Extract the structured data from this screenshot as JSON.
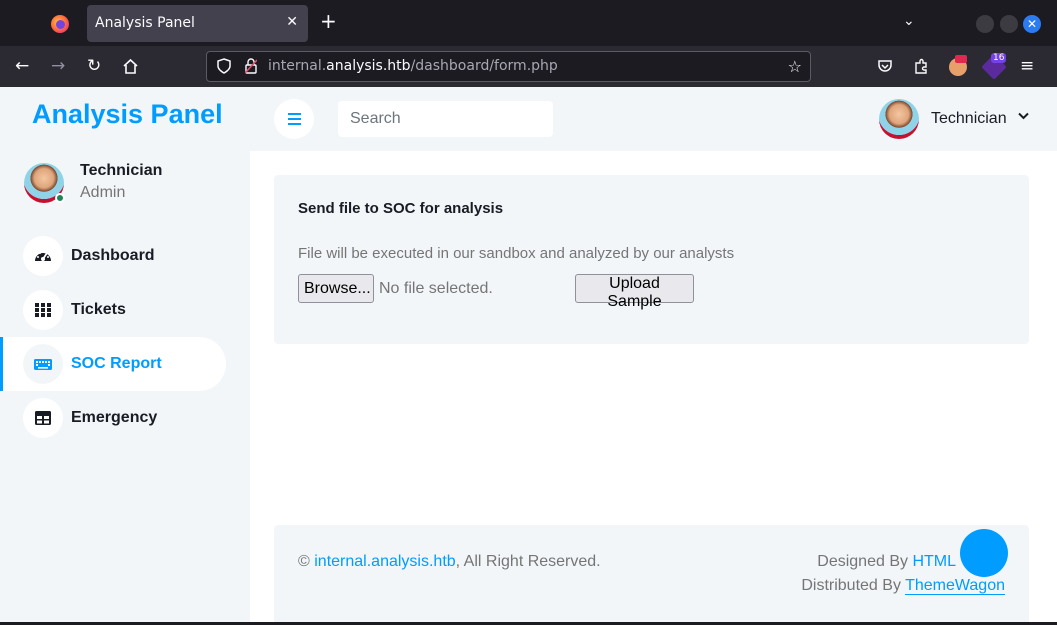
{
  "browser": {
    "tab_title": "Analysis Panel",
    "tab_close": "✕",
    "new_tab": "+",
    "tab_list": "⌄",
    "window_close": "✕",
    "url_prefix": "internal.",
    "url_host": "analysis.htb",
    "url_path": "/dashboard/form.php",
    "extension_badge": "16"
  },
  "sidebar": {
    "brand": "Analysis Panel",
    "user_name": "Technician",
    "user_role": "Admin",
    "items": [
      {
        "label": "Dashboard",
        "icon": "tachometer-icon",
        "active": false
      },
      {
        "label": "Tickets",
        "icon": "grid-icon",
        "active": false
      },
      {
        "label": "SOC Report",
        "icon": "keyboard-icon",
        "active": true
      },
      {
        "label": "Emergency",
        "icon": "table-icon",
        "active": false
      }
    ]
  },
  "header": {
    "search_placeholder": "Search",
    "user_name": "Technician"
  },
  "form": {
    "title": "Send file to SOC for analysis",
    "description": "File will be executed in our sandbox and analyzed by our analysts",
    "browse_label": "Browse...",
    "no_file_text": "No file selected.",
    "upload_label": "Upload Sample"
  },
  "footer": {
    "copyright_symbol": "©",
    "site_link": "internal.analysis.htb",
    "rights_text": ", All Right Reserved.",
    "designed_by": "Designed By",
    "designed_link": "HTML",
    "distributed_by": "Distributed By",
    "distributed_link": "ThemeWagon"
  },
  "colors": {
    "accent": "#009cff",
    "sidebar_bg": "#f3f6f9",
    "text_dark": "#191c24",
    "text_muted": "#757575"
  }
}
